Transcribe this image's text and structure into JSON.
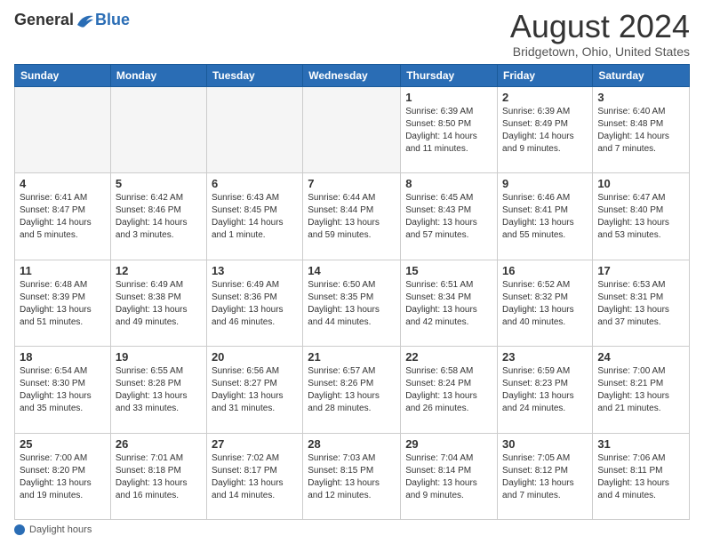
{
  "logo": {
    "general": "General",
    "blue": "Blue"
  },
  "header": {
    "title": "August 2024",
    "subtitle": "Bridgetown, Ohio, United States"
  },
  "days_of_week": [
    "Sunday",
    "Monday",
    "Tuesday",
    "Wednesday",
    "Thursday",
    "Friday",
    "Saturday"
  ],
  "weeks": [
    [
      {
        "day": "",
        "info": ""
      },
      {
        "day": "",
        "info": ""
      },
      {
        "day": "",
        "info": ""
      },
      {
        "day": "",
        "info": ""
      },
      {
        "day": "1",
        "info": "Sunrise: 6:39 AM\nSunset: 8:50 PM\nDaylight: 14 hours and 11 minutes."
      },
      {
        "day": "2",
        "info": "Sunrise: 6:39 AM\nSunset: 8:49 PM\nDaylight: 14 hours and 9 minutes."
      },
      {
        "day": "3",
        "info": "Sunrise: 6:40 AM\nSunset: 8:48 PM\nDaylight: 14 hours and 7 minutes."
      }
    ],
    [
      {
        "day": "4",
        "info": "Sunrise: 6:41 AM\nSunset: 8:47 PM\nDaylight: 14 hours and 5 minutes."
      },
      {
        "day": "5",
        "info": "Sunrise: 6:42 AM\nSunset: 8:46 PM\nDaylight: 14 hours and 3 minutes."
      },
      {
        "day": "6",
        "info": "Sunrise: 6:43 AM\nSunset: 8:45 PM\nDaylight: 14 hours and 1 minute."
      },
      {
        "day": "7",
        "info": "Sunrise: 6:44 AM\nSunset: 8:44 PM\nDaylight: 13 hours and 59 minutes."
      },
      {
        "day": "8",
        "info": "Sunrise: 6:45 AM\nSunset: 8:43 PM\nDaylight: 13 hours and 57 minutes."
      },
      {
        "day": "9",
        "info": "Sunrise: 6:46 AM\nSunset: 8:41 PM\nDaylight: 13 hours and 55 minutes."
      },
      {
        "day": "10",
        "info": "Sunrise: 6:47 AM\nSunset: 8:40 PM\nDaylight: 13 hours and 53 minutes."
      }
    ],
    [
      {
        "day": "11",
        "info": "Sunrise: 6:48 AM\nSunset: 8:39 PM\nDaylight: 13 hours and 51 minutes."
      },
      {
        "day": "12",
        "info": "Sunrise: 6:49 AM\nSunset: 8:38 PM\nDaylight: 13 hours and 49 minutes."
      },
      {
        "day": "13",
        "info": "Sunrise: 6:49 AM\nSunset: 8:36 PM\nDaylight: 13 hours and 46 minutes."
      },
      {
        "day": "14",
        "info": "Sunrise: 6:50 AM\nSunset: 8:35 PM\nDaylight: 13 hours and 44 minutes."
      },
      {
        "day": "15",
        "info": "Sunrise: 6:51 AM\nSunset: 8:34 PM\nDaylight: 13 hours and 42 minutes."
      },
      {
        "day": "16",
        "info": "Sunrise: 6:52 AM\nSunset: 8:32 PM\nDaylight: 13 hours and 40 minutes."
      },
      {
        "day": "17",
        "info": "Sunrise: 6:53 AM\nSunset: 8:31 PM\nDaylight: 13 hours and 37 minutes."
      }
    ],
    [
      {
        "day": "18",
        "info": "Sunrise: 6:54 AM\nSunset: 8:30 PM\nDaylight: 13 hours and 35 minutes."
      },
      {
        "day": "19",
        "info": "Sunrise: 6:55 AM\nSunset: 8:28 PM\nDaylight: 13 hours and 33 minutes."
      },
      {
        "day": "20",
        "info": "Sunrise: 6:56 AM\nSunset: 8:27 PM\nDaylight: 13 hours and 31 minutes."
      },
      {
        "day": "21",
        "info": "Sunrise: 6:57 AM\nSunset: 8:26 PM\nDaylight: 13 hours and 28 minutes."
      },
      {
        "day": "22",
        "info": "Sunrise: 6:58 AM\nSunset: 8:24 PM\nDaylight: 13 hours and 26 minutes."
      },
      {
        "day": "23",
        "info": "Sunrise: 6:59 AM\nSunset: 8:23 PM\nDaylight: 13 hours and 24 minutes."
      },
      {
        "day": "24",
        "info": "Sunrise: 7:00 AM\nSunset: 8:21 PM\nDaylight: 13 hours and 21 minutes."
      }
    ],
    [
      {
        "day": "25",
        "info": "Sunrise: 7:00 AM\nSunset: 8:20 PM\nDaylight: 13 hours and 19 minutes."
      },
      {
        "day": "26",
        "info": "Sunrise: 7:01 AM\nSunset: 8:18 PM\nDaylight: 13 hours and 16 minutes."
      },
      {
        "day": "27",
        "info": "Sunrise: 7:02 AM\nSunset: 8:17 PM\nDaylight: 13 hours and 14 minutes."
      },
      {
        "day": "28",
        "info": "Sunrise: 7:03 AM\nSunset: 8:15 PM\nDaylight: 13 hours and 12 minutes."
      },
      {
        "day": "29",
        "info": "Sunrise: 7:04 AM\nSunset: 8:14 PM\nDaylight: 13 hours and 9 minutes."
      },
      {
        "day": "30",
        "info": "Sunrise: 7:05 AM\nSunset: 8:12 PM\nDaylight: 13 hours and 7 minutes."
      },
      {
        "day": "31",
        "info": "Sunrise: 7:06 AM\nSunset: 8:11 PM\nDaylight: 13 hours and 4 minutes."
      }
    ]
  ],
  "footer": {
    "label": "Daylight hours"
  }
}
